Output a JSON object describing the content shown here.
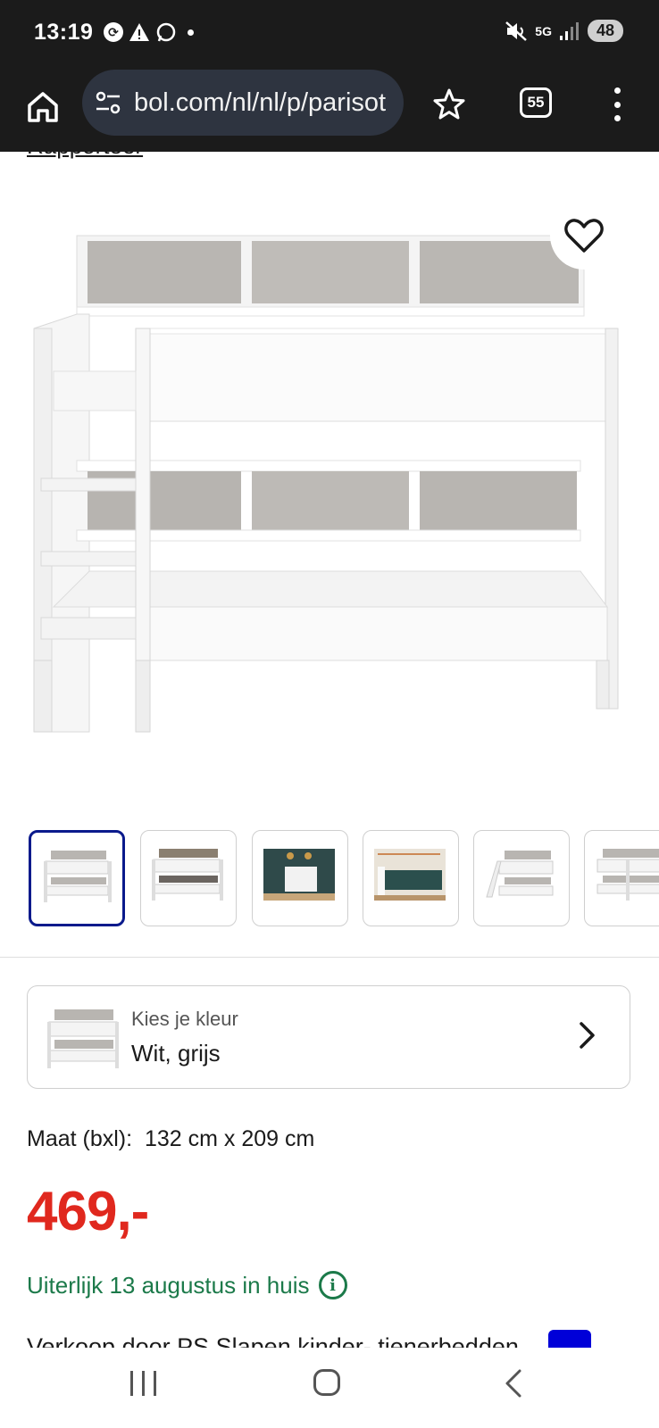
{
  "status_bar": {
    "time": "13:19",
    "network": "5G",
    "battery": "48",
    "icons": [
      "sync-icon",
      "warning-icon",
      "whatsapp-icon",
      "mute-icon",
      "signal-icon"
    ]
  },
  "browser": {
    "url": "bol.com/nl/nl/p/parisot",
    "tab_count": "55"
  },
  "page": {
    "cut_link": "Rapporteer",
    "color": {
      "label": "Kies je kleur",
      "value": "Wit, grijs"
    },
    "size": {
      "label": "Maat (bxl):",
      "value": "132 cm x 209 cm"
    },
    "price": "469,-",
    "delivery": "Uiterlijk 13 augustus in huis",
    "seller": "Verkoop door PS Slapen kinder- tienerbedden",
    "thumbnails": [
      {
        "name": "thumb-1",
        "active": true
      },
      {
        "name": "thumb-2",
        "active": false
      },
      {
        "name": "thumb-3",
        "active": false
      },
      {
        "name": "thumb-4",
        "active": false
      },
      {
        "name": "thumb-5",
        "active": false
      },
      {
        "name": "thumb-6",
        "active": false
      }
    ]
  },
  "colors": {
    "dark_bar": "#1b1b1b",
    "price_red": "#e0281e",
    "delivery_green": "#1c7a4a",
    "active_thumb_border": "#0a1a8c",
    "seller_badge_blue": "#0000d8"
  }
}
